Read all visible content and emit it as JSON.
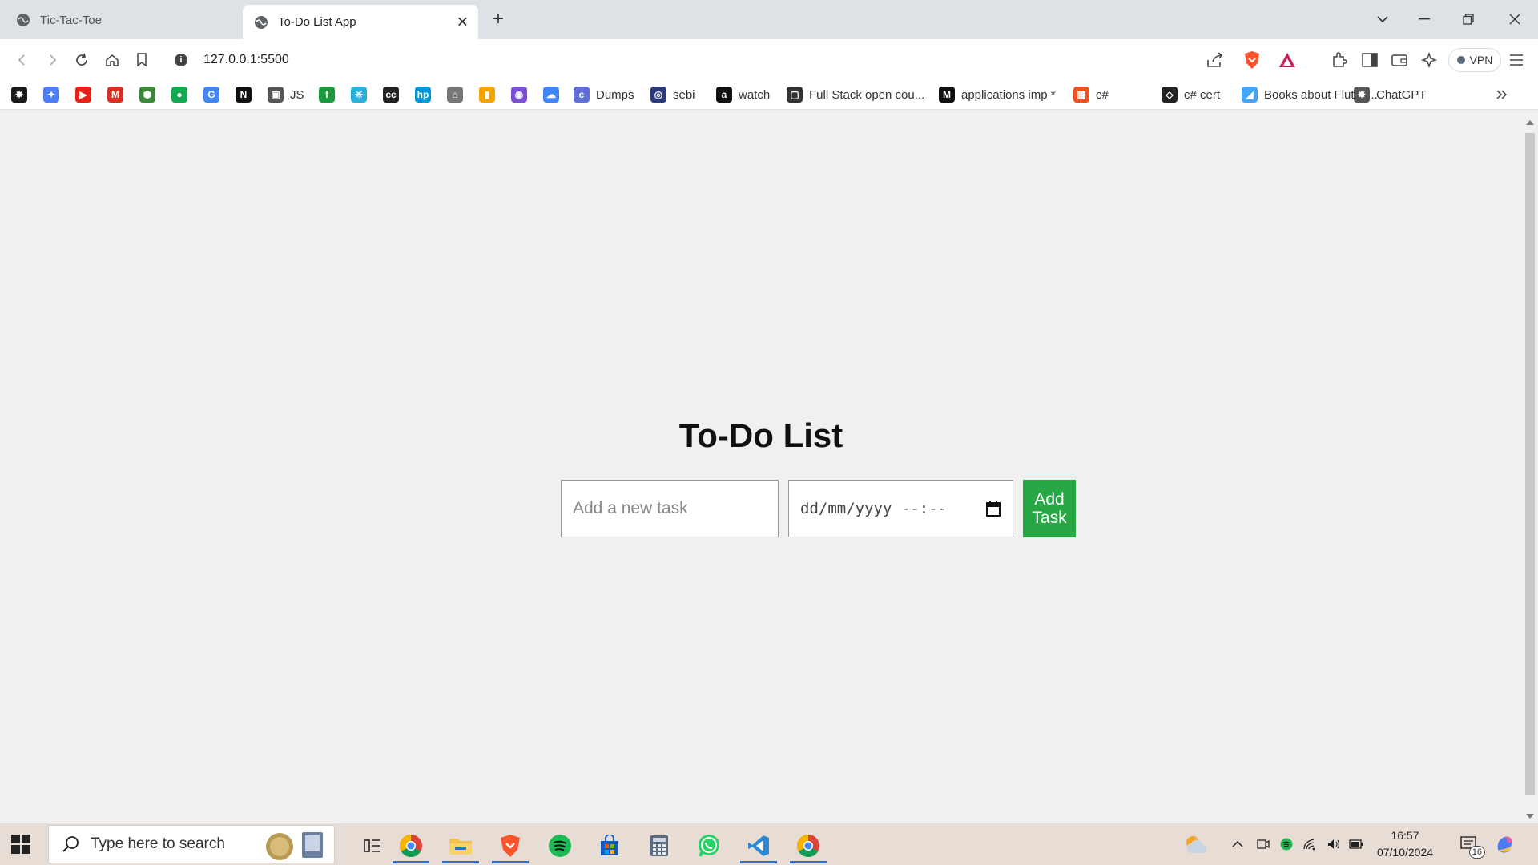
{
  "browser": {
    "tabs": [
      {
        "title": "Tic-Tac-Toe",
        "active": false
      },
      {
        "title": "To-Do List App",
        "active": true
      }
    ],
    "tab_close": "✕",
    "new_tab": "+",
    "address_url": "127.0.0.1:5500",
    "vpn_label": "VPN",
    "bookmarks": [
      {
        "label": "",
        "icon": "openai-icon",
        "color": "#1a1a1a",
        "glyph": "✸"
      },
      {
        "label": "",
        "icon": "gemini-icon",
        "color": "#4f7cf7",
        "glyph": "✦"
      },
      {
        "label": "",
        "icon": "youtube-icon",
        "color": "#e62117",
        "glyph": "▶"
      },
      {
        "label": "",
        "icon": "gmail-icon",
        "color": "#d93025",
        "glyph": "M"
      },
      {
        "label": "",
        "icon": "nodejs-icon",
        "color": "#3c873a",
        "glyph": "⬢"
      },
      {
        "label": "",
        "icon": "mongodb-icon",
        "color": "#13aa52",
        "glyph": "●"
      },
      {
        "label": "",
        "icon": "google-icon",
        "color": "#4285f4",
        "glyph": "G"
      },
      {
        "label": "",
        "icon": "notion-icon",
        "color": "#111111",
        "glyph": "N"
      },
      {
        "label": "JS",
        "icon": "js-folder-icon",
        "color": "#555555",
        "glyph": "▣"
      },
      {
        "label": "",
        "icon": "freecodecamp-icon",
        "color": "#1d9a3f",
        "glyph": "f"
      },
      {
        "label": "",
        "icon": "sparkle-icon",
        "color": "#2bb0d8",
        "glyph": "✳"
      },
      {
        "label": "",
        "icon": "cc-icon",
        "color": "#222222",
        "glyph": "cc"
      },
      {
        "label": "",
        "icon": "hp-icon",
        "color": "#0096d6",
        "glyph": "hp"
      },
      {
        "label": "",
        "icon": "graduation-icon",
        "color": "#777777",
        "glyph": "⌂"
      },
      {
        "label": "",
        "icon": "analytics-icon",
        "color": "#f4a300",
        "glyph": "▮"
      },
      {
        "label": "",
        "icon": "firefox-relay-icon",
        "color": "#7b4fd6",
        "glyph": "◉"
      },
      {
        "label": "",
        "icon": "google-cloud-icon",
        "color": "#4285f4",
        "glyph": "☁"
      },
      {
        "label": "Dumps",
        "icon": "dumps-icon",
        "color": "#5f6fd6",
        "glyph": "c"
      },
      {
        "label": "sebi",
        "icon": "sebi-icon",
        "color": "#2b3a78",
        "glyph": "◎"
      },
      {
        "label": "watch",
        "icon": "amazon-icon",
        "color": "#111111",
        "glyph": "a"
      },
      {
        "label": "Full Stack open cou...",
        "icon": "fullstack-icon",
        "color": "#333333",
        "glyph": "▢"
      },
      {
        "label": "applications imp *",
        "icon": "medium-icon",
        "color": "#111111",
        "glyph": "M"
      },
      {
        "label": "c#",
        "icon": "microsoft-icon",
        "color": "#f25022",
        "glyph": "▦"
      },
      {
        "label": "c# cert",
        "icon": "csharp-cert-icon",
        "color": "#222222",
        "glyph": "◇"
      },
      {
        "label": "Books about Flutter...",
        "icon": "flutter-icon",
        "color": "#42a5f5",
        "glyph": "◢"
      },
      {
        "label": "ChatGPT",
        "icon": "chatgpt-icon",
        "color": "#555555",
        "glyph": "✸"
      }
    ]
  },
  "app": {
    "title": "To-Do List",
    "task_placeholder": "Add a new task",
    "datetime_placeholder": "dd/mm/yyyy  --:--",
    "add_button_line1": "Add",
    "add_button_line2": "Task"
  },
  "taskbar": {
    "search_placeholder": "Type here to search",
    "time": "16:57",
    "date": "07/10/2024",
    "notification_count": "16"
  },
  "colors": {
    "add_button": "#28a745",
    "page_background": "#f0f0f0",
    "taskbar_background": "#e8ddd4"
  }
}
